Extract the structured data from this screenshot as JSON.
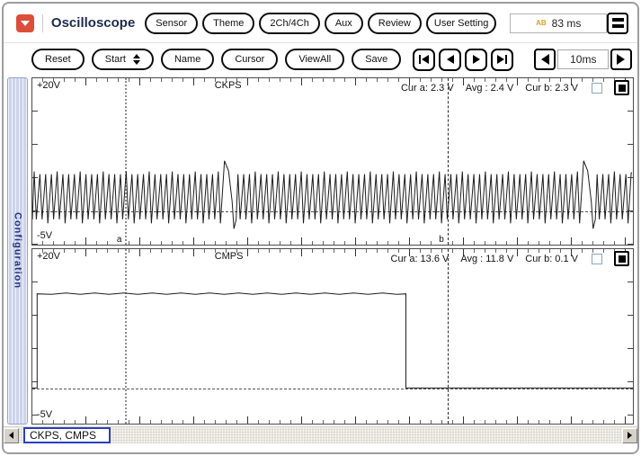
{
  "window_frame": {
    "title": "Oscilloscope",
    "time_display": "83 ms",
    "ab_icon_text": "AB"
  },
  "titlebar_buttons": [
    "Sensor",
    "Theme",
    "2Ch/4Ch",
    "Aux",
    "Review",
    "User Setting"
  ],
  "toolbar_buttons": [
    "Reset",
    "Start",
    "Name",
    "Cursor",
    "ViewAll",
    "Save"
  ],
  "toolbar": {
    "timebase": "10ms"
  },
  "sidebar": {
    "tab_label": "Configuration"
  },
  "scale": {
    "v_top": 20,
    "v_bottom": -5
  },
  "cursors": {
    "a_x_frac": 0.154,
    "b_x_frac": 0.692,
    "a_label": "a",
    "b_label": "b"
  },
  "channels": [
    {
      "name": "CKPS",
      "top_label": "+20V",
      "bottom_label": "-5V",
      "cur_a": "Cur a: 2.3 V",
      "avg": "Avg : 2.4 V",
      "cur_b": "Cur b: 2.3 V",
      "waveform": {
        "kind": "teeth",
        "period": 6.4,
        "peak_v": 5.6,
        "valley_v": -1.2,
        "event_x_frac": [
          0.312,
          0.91
        ],
        "event_peak_v": 7.6,
        "event_dip_v": -2.6,
        "end_plateau_v": 5.8
      }
    },
    {
      "name": "CMPS",
      "top_label": "+20V",
      "bottom_label": "-5V",
      "cur_a": "Cur a: 13.6 V",
      "avg": "Avg : 11.8 V",
      "cur_b": "Cur b: 0.1 V",
      "waveform": {
        "kind": "square",
        "high_v": 13.6,
        "low_v": 0.1,
        "rise_x_frac": 0.008,
        "fall_x_frac": 0.622
      }
    }
  ],
  "statusbar": {
    "label": "CKPS, CMPS"
  },
  "icons": {
    "app-icon": "red rounded square with white chevron-down",
    "ab-cursors-icon": "orange AB cursor-time glyph",
    "menu-icon": "square with two horizontal bars",
    "skip-start-icon": "bar + left triangle",
    "prev-icon": "left triangle",
    "next-icon": "right triangle",
    "skip-end-icon": "right triangle + bar",
    "timebase-left-icon": "bar + left triangle",
    "timebase-right-icon": "right triangle + bar",
    "start-spinner-icon": "up/down triangles"
  },
  "chart_data": [
    {
      "type": "line",
      "title": "CKPS",
      "y_unit": "V",
      "y_range": [
        -5,
        20
      ],
      "timebase_per_div": "10ms",
      "grid": false,
      "cursor_a_v": 2.3,
      "avg_v": 2.4,
      "cursor_b_v": 2.3,
      "signal": "crankshaft position sensor AC tooth waveform, peaks ~5.6V, valleys ~-1.2V, two missing-tooth events at ~31% and ~91% of window, high plateau at right edge"
    },
    {
      "type": "line",
      "title": "CMPS",
      "y_unit": "V",
      "y_range": [
        -5,
        20
      ],
      "timebase_per_div": "10ms",
      "grid": false,
      "cursor_a_v": 13.6,
      "avg_v": 11.8,
      "cursor_b_v": 0.1,
      "signal": "camshaft position sensor square pulse: rises at left edge to 13.6V, stays high until ~62% of window, then low 0.1V to right edge"
    }
  ]
}
